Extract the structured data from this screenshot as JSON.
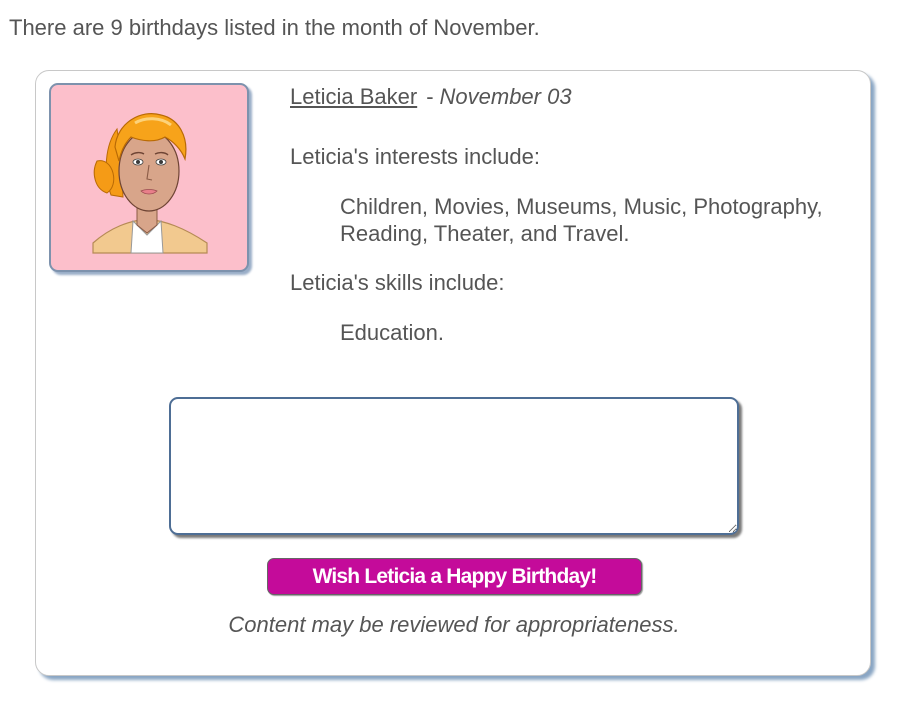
{
  "summary": "There are 9 birthdays listed in the month of November.",
  "person": {
    "name": "Leticia Baker",
    "separator": "-",
    "birthday": "November 03",
    "interests_heading": "Leticia's interests include:",
    "interests": "Children, Movies, Museums, Music, Photography, Reading, Theater, and Travel.",
    "skills_heading": "Leticia's skills include:",
    "skills": "Education."
  },
  "message": {
    "value": "",
    "placeholder": ""
  },
  "wish_button_label": "Wish Leticia a Happy Birthday!",
  "moderation_note": "Content may be reviewed for appropriateness.",
  "colors": {
    "avatar_background": "#fcbfcb",
    "button_background": "#c40b9a",
    "card_shadow": "#8aa6c4",
    "text": "#555555"
  },
  "icons": {
    "avatar": "woman-avatar-illustration"
  }
}
